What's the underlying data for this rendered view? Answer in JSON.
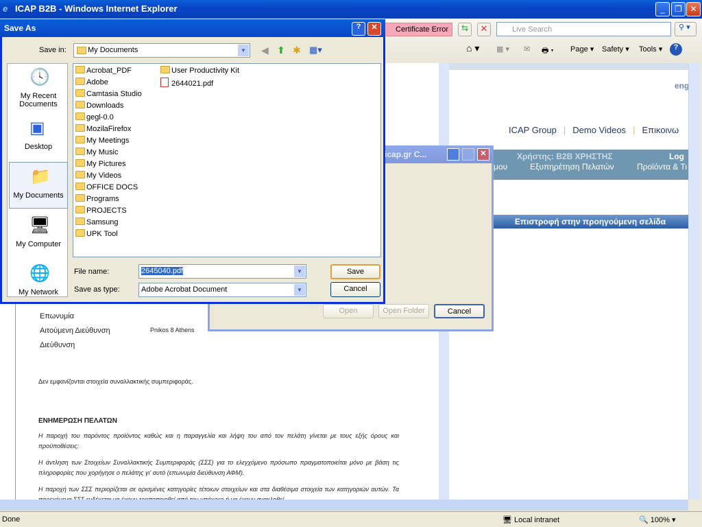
{
  "browser": {
    "title": "ICAP B2B - Windows Internet Explorer",
    "cert_error": "Certificate Error",
    "search_placeholder": "Live Search",
    "commands": {
      "page": "Page",
      "safety": "Safety",
      "tools": "Tools"
    },
    "status": "Done",
    "zone": "Local intranet",
    "zoom": "100%"
  },
  "webpage": {
    "lang": "eng",
    "nav": [
      "ICAP Group",
      "Demo Videos",
      "Επικοινω"
    ],
    "user": "Χρήστης: B2B ΧΡΗΣΤΗΣ",
    "log": "Log",
    "menu": [
      "μου",
      "Εξυπηρέτηση Πελατών",
      "Προϊόντα & Τι"
    ],
    "back_bar": "Επιστροφή στην προηγούμενη σελίδα",
    "fields": {
      "name": "Επωνυμία",
      "req_addr": "Αιτούμενη Διεύθυνση",
      "req_addr_value": "Pnikos 8  Athens",
      "addr": "Διεύθυνση"
    },
    "no_data": "Δεν εμφανίζονται στοιχεία συναλλακτικής συμπεριφοράς.",
    "section": "ΕΝΗΜΕΡΩΣΗ ΠΕΛΑΤΩΝ",
    "paragraphs": [
      "Η παροχή του παρόντος προϊόντος καθώς και η παραγγελία και λήψη του από τον πελάτη γίνεται με τους εξής όρους και προϋποθέσεις:",
      "Η άντληση των Στοιχείων Συναλλακτικής Συμπεριφοράς (ΣΣΣ) για το ελεγχόμενο πρόσωπο πραγματοποιείται μόνο με βάση τις πληροφορίες που χορήγησε ο πελάτης γι' αυτό (επωνυμία διεύθυνση ΑΦΜ).",
      "Η παροχή των ΣΣΣ περιορίζεται σε ορισμένες κατηγορίες τέτοιων στοιχείων και στα διαθέσιμα στοιχεία των κατηγοριών αυτών. Τα παρεχόμενα ΣΣΣ ενδέχεται να έχουν τροποποιηθεί από τον υπόχρεο ή να έχουν ανακληθεί"
    ]
  },
  "download_dialog": {
    "title": "e.icap.gr C...",
    "open": "Open",
    "open_folder": "Open Folder",
    "cancel": "Cancel"
  },
  "save_as": {
    "title": "Save As",
    "save_in_label": "Save in:",
    "save_in": "My Documents",
    "places": [
      "My Recent Documents",
      "Desktop",
      "My Documents",
      "My Computer",
      "My Network"
    ],
    "files_col1": [
      "Acrobat_PDF",
      "Adobe",
      "Camtasia Studio",
      "Downloads",
      "gegl-0.0",
      "MozilaFirefox",
      "My Meetings",
      "My Music",
      "My Pictures",
      "My Videos",
      "OFFICE DOCS",
      "Programs",
      "PROJECTS",
      "Samsung",
      "UPK Tool"
    ],
    "files_col2": [
      {
        "name": "User Productivity Kit",
        "type": "folder"
      },
      {
        "name": "2644021.pdf",
        "type": "pdf"
      }
    ],
    "file_name_label": "File name:",
    "file_name": "2645040.pdf",
    "type_label": "Save as type:",
    "type": "Adobe Acrobat Document",
    "save": "Save",
    "cancel": "Cancel"
  }
}
